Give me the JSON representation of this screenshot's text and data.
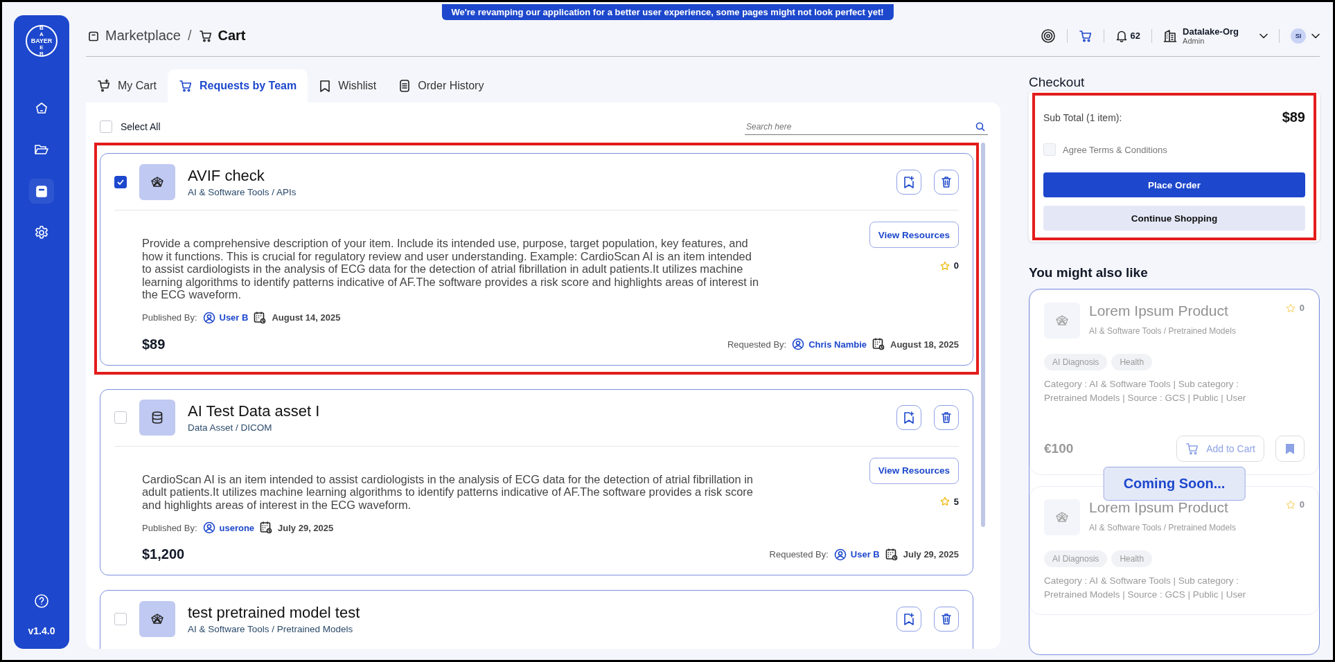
{
  "banner": "We're revamping our application for a better user experience, some pages might not look perfect yet!",
  "sidebar": {
    "logo": {
      "horizontal": "BAYER",
      "vertical_top": "BA",
      "vertical_bottom": "ER"
    },
    "items": [
      {
        "selected": false
      },
      {
        "selected": false
      },
      {
        "selected": true
      },
      {
        "selected": false
      }
    ],
    "version": "v1.4.0"
  },
  "breadcrumb": {
    "items": [
      "Marketplace",
      "Cart"
    ],
    "separator": "/"
  },
  "header": {
    "notifications": "62",
    "org": {
      "name": "Datalake-Org",
      "role": "Admin"
    },
    "avatar": "SI"
  },
  "tabs": [
    {
      "label": "My Cart",
      "selected": false
    },
    {
      "label": "Requests by Team",
      "selected": true
    },
    {
      "label": "Wishlist",
      "selected": false
    },
    {
      "label": "Order History",
      "selected": false
    }
  ],
  "cart": {
    "select_all": {
      "label": "Select All",
      "checked": false
    },
    "search": {
      "placeholder": "Search here"
    },
    "items": [
      {
        "kind": "model",
        "title": "AVIF check",
        "category": "AI & Software Tools / APIs",
        "checked": true,
        "highlighted": true,
        "description": "Provide a comprehensive description of your item. Include its intended use, purpose, target population, key features, and how it functions. This is crucial for regulatory review and user understanding. Example: CardioScan AI is an item intended to assist cardiologists in the analysis of ECG data for the detection of atrial fibrillation in adult patients.It utilizes machine learning algorithms to identify patterns indicative of AF.The software provides a risk score and highlights areas of interest in the ECG waveform.",
        "view_button": "View Resources",
        "rating": "0",
        "published_label": "Published By:",
        "publisher": "User B",
        "published_date": "August 14, 2025",
        "price": "$89",
        "requested_label": "Requested By:",
        "requester": "Chris Nambie",
        "requested_date": "August 18, 2025"
      },
      {
        "kind": "dataset",
        "title": "AI Test Data asset I",
        "category": "Data Asset / DICOM",
        "checked": false,
        "highlighted": false,
        "description": "CardioScan AI is an item intended to assist cardiologists in the analysis of ECG data for the detection of atrial fibrillation in adult patients.It utilizes machine learning algorithms to identify patterns indicative of AF.The software provides a risk score and highlights areas of interest in the ECG waveform.",
        "view_button": "View Resources",
        "rating": "5",
        "published_label": "Published By:",
        "publisher": "userone",
        "published_date": "July 29, 2025",
        "price": "$1,200",
        "requested_label": "Requested By:",
        "requester": "User B",
        "requested_date": "July 29, 2025"
      },
      {
        "kind": "model",
        "title": "test pretrained model test",
        "category": "AI & Software Tools / Pretrained Models",
        "checked": false,
        "highlighted": false
      }
    ]
  },
  "checkout": {
    "title": "Checkout",
    "highlighted": true,
    "subtotal_label": "Sub Total (1 item):",
    "subtotal": "$89",
    "terms": {
      "label": "Agree Terms & Conditions",
      "checked": false
    },
    "place_order": "Place Order",
    "continue": "Continue Shopping"
  },
  "recommendations": {
    "title": "You might also like",
    "disabled": true,
    "overlay": "Coming Soon...",
    "items": [
      {
        "title": "Lorem Ipsum Product",
        "rating": "0",
        "category": "AI & Software Tools / Pretrained Models",
        "tags": [
          "AI Diagnosis",
          "Health"
        ],
        "description": "Category : AI & Software Tools | Sub category : Pretrained Models | Source : GCS | Public | User",
        "price": "€100",
        "cart_button": "Add to Cart"
      },
      {
        "title": "Lorem Ipsum Product",
        "rating": "0",
        "category": "AI & Software Tools / Pretrained Models",
        "tags": [
          "AI Diagnosis",
          "Health"
        ],
        "description": "Category : AI & Software Tools | Sub category : Pretrained Models | Source : GCS | Public | User"
      }
    ]
  }
}
